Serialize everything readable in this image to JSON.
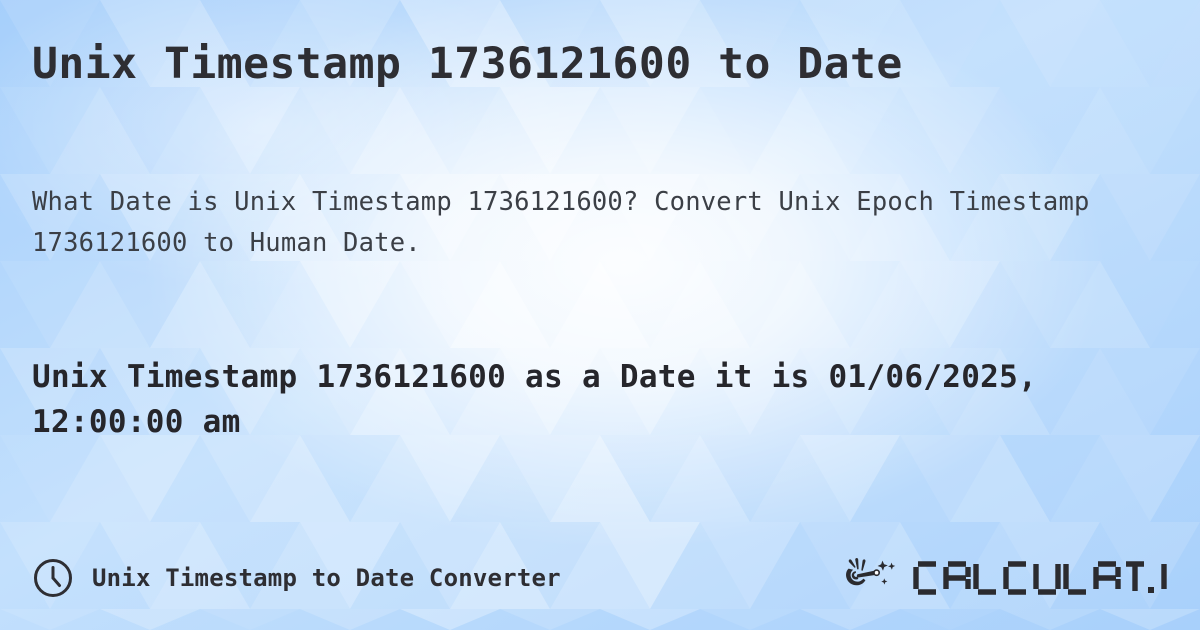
{
  "page": {
    "title": "Unix Timestamp 1736121600 to Date",
    "description": "What Date is Unix Timestamp 1736121600? Convert Unix Epoch Timestamp 1736121600 to Human Date.",
    "result": "Unix Timestamp 1736121600 as a Date it is 01/06/2025, 12:00:00 am"
  },
  "values": {
    "timestamp": "1736121600",
    "date": "01/06/2025",
    "time": "12:00:00 am"
  },
  "footer": {
    "icon": "clock-icon",
    "label": "Unix Timestamp to Date Converter",
    "brand_icon": "magic-wand-hand-icon",
    "brand_text": "CALCULAT.IO"
  },
  "colors": {
    "background_base": "#aed3fb",
    "background_highlight": "#ffffff",
    "text_primary": "#2e2e33",
    "text_secondary": "#3b3f46",
    "logo": "#2b2b2f"
  }
}
